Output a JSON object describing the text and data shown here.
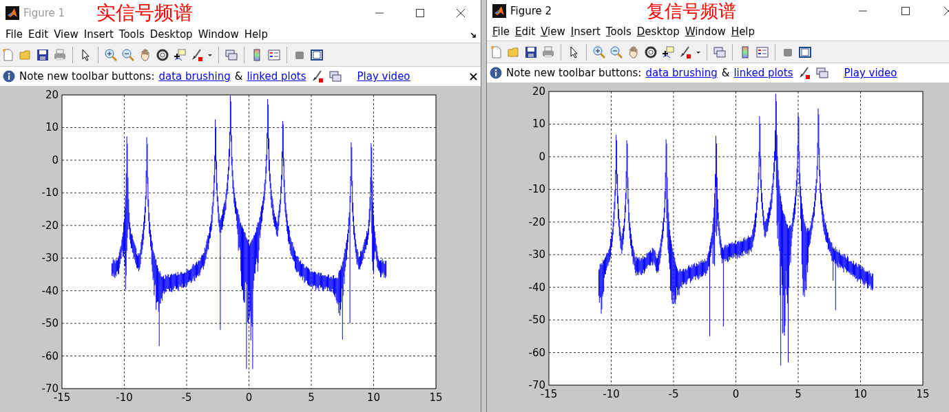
{
  "figures": [
    {
      "title": "Figure 1",
      "active": false,
      "annotation": "实信号频谱",
      "menu": [
        "File",
        "Edit",
        "View",
        "Insert",
        "Tools",
        "Desktop",
        "Window",
        "Help"
      ],
      "mnemonics_underlined": false,
      "dock_arrow": true,
      "info": {
        "text": "Note new toolbar buttons:",
        "link_1": "data brushing",
        "joiner": "&",
        "link_2": "linked plots",
        "video_link": "Play video",
        "dismissible": true
      },
      "axes": {
        "yticks": [
          "20",
          "10",
          "0",
          "-10",
          "-20",
          "-30",
          "-40",
          "-50",
          "-60",
          "-70"
        ],
        "xticks": [
          "-15",
          "-10",
          "-5",
          "0",
          "5",
          "10",
          "15"
        ]
      }
    },
    {
      "title": "Figure 2",
      "active": true,
      "annotation": "复信号频谱",
      "menu": [
        "File",
        "Edit",
        "View",
        "Insert",
        "Tools",
        "Desktop",
        "Window",
        "Help"
      ],
      "mnemonics_underlined": true,
      "dock_arrow": false,
      "info": {
        "text": "Note new toolbar buttons:",
        "link_1": "data brushing",
        "joiner": "&",
        "link_2": "linked plots",
        "video_link": "Play video",
        "dismissible": false
      },
      "axes": {
        "yticks": [
          "20",
          "10",
          "0",
          "-10",
          "-20",
          "-30",
          "-40",
          "-50",
          "-60",
          "-70"
        ],
        "xticks": [
          "-15",
          "-10",
          "-5",
          "0",
          "5",
          "10",
          "15"
        ]
      }
    }
  ]
}
